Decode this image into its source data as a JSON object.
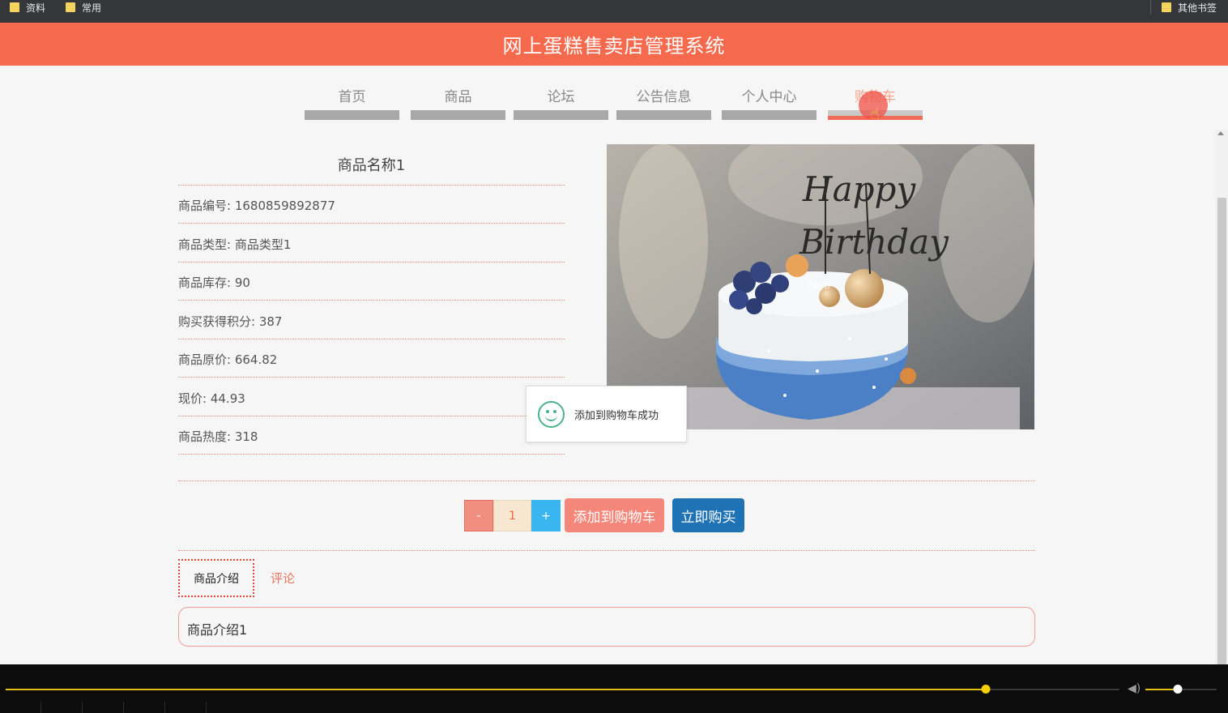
{
  "bookmarks": {
    "items": [
      {
        "label": "资料",
        "icon": "folder-icon"
      },
      {
        "label": "常用",
        "icon": "folder-icon"
      }
    ],
    "other": {
      "label": "其他书签",
      "icon": "folder-icon"
    }
  },
  "header": {
    "title": "网上蛋糕售卖店管理系统"
  },
  "nav": {
    "items": [
      {
        "label": "首页"
      },
      {
        "label": "商品"
      },
      {
        "label": "论坛"
      },
      {
        "label": "公告信息"
      },
      {
        "label": "个人中心"
      },
      {
        "label": "购物车",
        "active": true
      }
    ]
  },
  "product": {
    "name": "商品名称1",
    "details": [
      {
        "label": "商品编号",
        "value": "1680859892877"
      },
      {
        "label": "商品类型",
        "value": "商品类型1"
      },
      {
        "label": "商品库存",
        "value": "90"
      },
      {
        "label": "购买获得积分",
        "value": "387"
      },
      {
        "label": "商品原价",
        "value": "664.82"
      },
      {
        "label": "现价",
        "value": "44.93"
      },
      {
        "label": "商品热度",
        "value": "318"
      }
    ],
    "image": {
      "topper_text": "Happy Birthday",
      "watermark": "小红书"
    }
  },
  "toast": {
    "message": "添加到购物车成功",
    "icon": "smile-icon"
  },
  "purchase": {
    "minus_label": "-",
    "quantity": "1",
    "plus_label": "+",
    "add_to_cart_label": "添加到购物车",
    "buy_now_label": "立即购买"
  },
  "tabs": {
    "intro_label": "商品介绍",
    "comment_label": "评论",
    "intro_content": "商品介绍1"
  },
  "player": {
    "progress": 0.88,
    "volume": 0.45
  },
  "colors": {
    "header": "#f5694d",
    "accent": "#f26b57",
    "buy_button": "#1f73b5",
    "plus_button": "#39b6ef",
    "player_progress": "#e0c010"
  }
}
